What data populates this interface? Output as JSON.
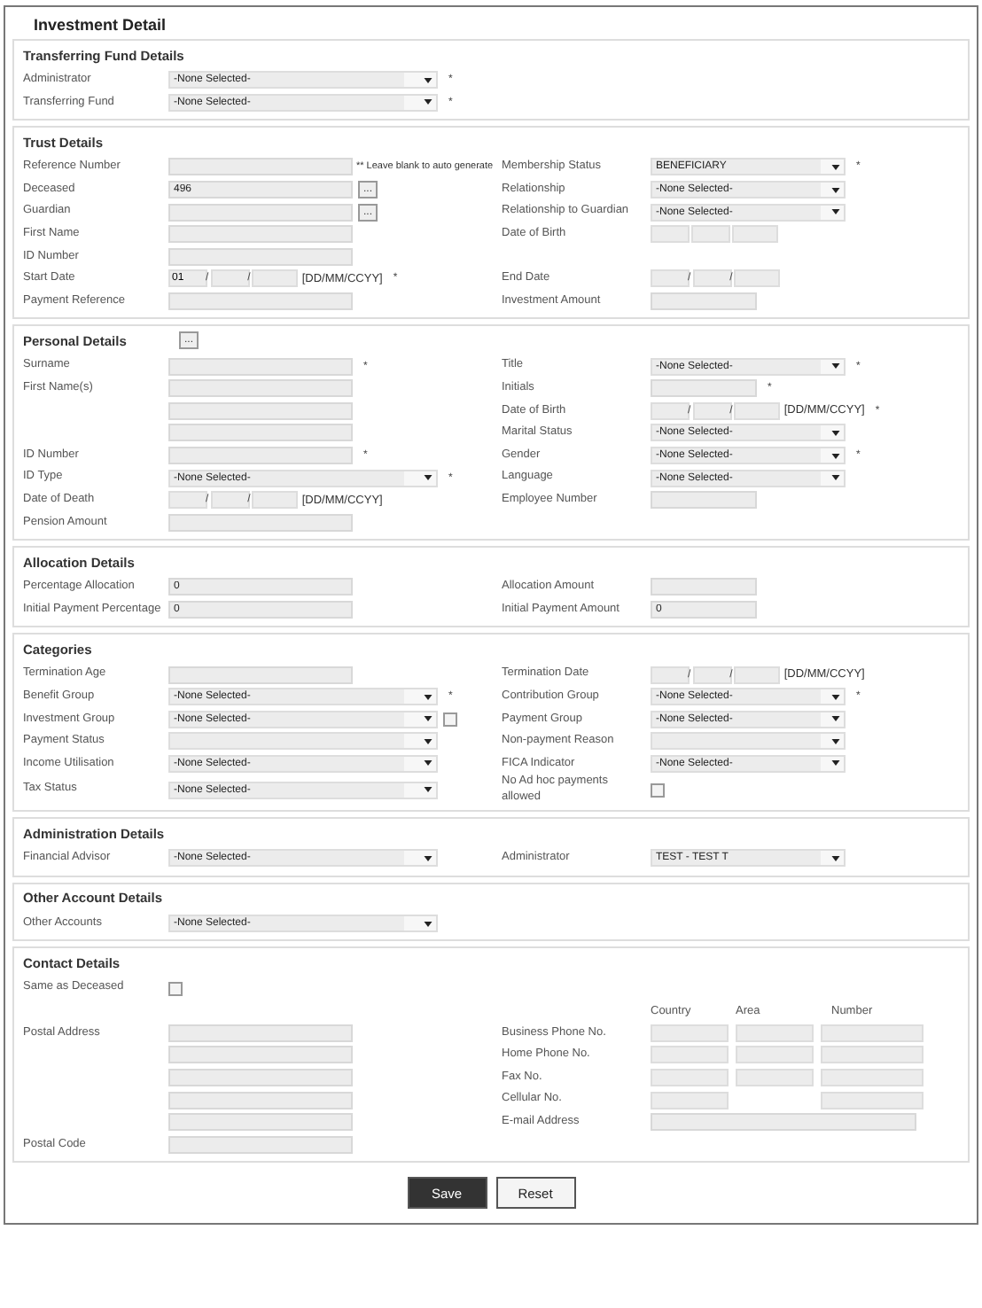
{
  "page_title": "Investment Detail",
  "sections": [
    {
      "title": "Transferring Fund Details",
      "rows": [
        {
          "left": {
            "label": "Administrator",
            "controls": [
              {
                "kind": "select",
                "value": "-None Selected-"
              }
            ],
            "mark": "*"
          }
        },
        {
          "left": {
            "label": "Transferring Fund",
            "controls": [
              {
                "kind": "select",
                "value": "-None Selected-"
              }
            ],
            "mark": "*"
          }
        }
      ]
    },
    {
      "title": "Trust Details",
      "rows": [
        {
          "left": {
            "label": "Reference Number",
            "controls": [
              {
                "kind": "text"
              }
            ],
            "note": "** Leave blank to auto generate"
          },
          "right": {
            "label": "Membership Status",
            "controls": [
              {
                "kind": "select",
                "value": "BENEFICIARY"
              }
            ],
            "mark": "*"
          }
        },
        {
          "left": {
            "label": "Deceased",
            "controls": [
              {
                "kind": "text",
                "value": "496"
              },
              {
                "kind": "button",
                "text": "..."
              }
            ]
          },
          "right": {
            "label": "Relationship",
            "controls": [
              {
                "kind": "select",
                "value": "-None Selected-"
              }
            ]
          }
        },
        {
          "left": {
            "label": "Guardian",
            "controls": [
              {
                "kind": "text"
              },
              {
                "kind": "button",
                "text": "..."
              }
            ]
          },
          "right": {
            "label": "Relationship to Guardian",
            "controls": [
              {
                "kind": "select",
                "value": "-None Selected-"
              }
            ]
          }
        },
        {
          "left": {
            "label": "First Name",
            "controls": [
              {
                "kind": "text"
              }
            ]
          },
          "right": {
            "label": "Date of Birth",
            "controls": [
              {
                "kind": "date"
              }
            ]
          }
        },
        {
          "left": {
            "label": "ID Number",
            "controls": [
              {
                "kind": "text"
              }
            ]
          }
        },
        {
          "left": {
            "label": "Start Date",
            "controls": [
              {
                "kind": "date",
                "day": "01",
                "separator": "/",
                "format": "[DD/MM/CCYY]"
              }
            ],
            "mark": "*"
          },
          "right": {
            "label": "End Date",
            "controls": [
              {
                "kind": "date",
                "separator": "/"
              }
            ]
          }
        },
        {
          "left": {
            "label": "Payment Reference",
            "controls": [
              {
                "kind": "text"
              }
            ]
          },
          "right": {
            "label": "Investment Amount",
            "controls": [
              {
                "kind": "text"
              }
            ]
          }
        }
      ]
    },
    {
      "title": "Personal Details",
      "button": "...",
      "rows": [
        {
          "left": {
            "label": "Surname",
            "controls": [
              {
                "kind": "text"
              }
            ],
            "mark": "*"
          },
          "right": {
            "label": "Title",
            "controls": [
              {
                "kind": "select",
                "value": "-None Selected-"
              }
            ],
            "mark": "*"
          }
        },
        {
          "left": {
            "label": "First Name(s)",
            "controls": [
              {
                "kind": "text"
              }
            ]
          },
          "right": {
            "label": "Initials",
            "controls": [
              {
                "kind": "text"
              }
            ],
            "mark": "*"
          }
        },
        {
          "left": {
            "controls": [
              {
                "kind": "text"
              }
            ]
          },
          "right": {
            "label": "Date of Birth",
            "controls": [
              {
                "kind": "date",
                "separator": "/",
                "format": "[DD/MM/CCYY]"
              }
            ],
            "mark": "*"
          }
        },
        {
          "left": {
            "controls": [
              {
                "kind": "text"
              }
            ]
          },
          "right": {
            "label": "Marital Status",
            "controls": [
              {
                "kind": "select",
                "value": "-None Selected-"
              }
            ]
          }
        },
        {
          "left": {
            "label": "ID Number",
            "controls": [
              {
                "kind": "text"
              }
            ],
            "mark": "*"
          },
          "right": {
            "label": "Gender",
            "controls": [
              {
                "kind": "select",
                "value": "-None Selected-"
              }
            ],
            "mark": "*"
          }
        },
        {
          "left": {
            "label": "ID Type",
            "controls": [
              {
                "kind": "select",
                "value": "-None Selected-"
              }
            ],
            "mark": "*"
          },
          "right": {
            "label": "Language",
            "controls": [
              {
                "kind": "select",
                "value": "-None Selected-"
              }
            ]
          }
        },
        {
          "left": {
            "label": "Date of Death",
            "controls": [
              {
                "kind": "date",
                "separator": "/",
                "format": "[DD/MM/CCYY]"
              }
            ]
          },
          "right": {
            "label": "Employee Number",
            "controls": [
              {
                "kind": "text"
              }
            ]
          }
        },
        {
          "left": {
            "label": "Pension Amount",
            "controls": [
              {
                "kind": "text"
              }
            ]
          }
        }
      ]
    },
    {
      "title": "Allocation Details",
      "rows": [
        {
          "left": {
            "label": "Percentage Allocation",
            "controls": [
              {
                "kind": "text",
                "value": "0"
              }
            ]
          },
          "right": {
            "label": "Allocation Amount",
            "controls": [
              {
                "kind": "text"
              }
            ]
          }
        },
        {
          "left": {
            "label": "Initial Payment Percentage",
            "controls": [
              {
                "kind": "text",
                "value": "0"
              }
            ]
          },
          "right": {
            "label": "Initial Payment Amount",
            "controls": [
              {
                "kind": "text",
                "value": "0"
              }
            ]
          }
        }
      ]
    },
    {
      "title": "Categories",
      "rows": [
        {
          "left": {
            "label": "Termination Age",
            "controls": [
              {
                "kind": "text"
              }
            ]
          },
          "right": {
            "label": "Termination Date",
            "controls": [
              {
                "kind": "date",
                "separator": "/",
                "format": "[DD/MM/CCYY]"
              }
            ]
          }
        },
        {
          "left": {
            "label": "Benefit Group",
            "controls": [
              {
                "kind": "select",
                "value": "-None Selected-"
              }
            ],
            "mark": "*"
          },
          "right": {
            "label": "Contribution Group",
            "controls": [
              {
                "kind": "select",
                "value": "-None Selected-"
              }
            ],
            "mark": "*"
          }
        },
        {
          "left": {
            "label": "Investment Group",
            "controls": [
              {
                "kind": "select",
                "value": "-None Selected-"
              },
              {
                "kind": "checkbox",
                "checked": false
              }
            ]
          },
          "right": {
            "label": "Payment Group",
            "controls": [
              {
                "kind": "select",
                "value": "-None Selected-"
              }
            ]
          }
        },
        {
          "left": {
            "label": "Payment Status",
            "controls": [
              {
                "kind": "select"
              }
            ]
          },
          "right": {
            "label": "Non-payment Reason",
            "controls": [
              {
                "kind": "select"
              }
            ]
          }
        },
        {
          "left": {
            "label": "Income Utilisation",
            "controls": [
              {
                "kind": "select",
                "value": "-None Selected-"
              }
            ]
          },
          "right": {
            "label": "FICA Indicator",
            "controls": [
              {
                "kind": "select",
                "value": "-None Selected-"
              }
            ]
          }
        },
        {
          "left": {
            "label": "Tax Status",
            "controls": [
              {
                "kind": "select",
                "value": "-None Selected-"
              }
            ]
          },
          "right": {
            "label": "No Ad hoc payments allowed",
            "controls": [
              {
                "kind": "checkbox",
                "checked": false
              }
            ]
          }
        }
      ]
    },
    {
      "title": "Administration Details",
      "rows": [
        {
          "left": {
            "label": "Financial Advisor",
            "controls": [
              {
                "kind": "select",
                "value": "-None Selected-"
              }
            ]
          },
          "right": {
            "label": "Administrator",
            "controls": [
              {
                "kind": "select",
                "value": "TEST - TEST T"
              }
            ]
          }
        }
      ]
    },
    {
      "title": "Other Account Details",
      "rows": [
        {
          "left": {
            "label": "Other Accounts",
            "controls": [
              {
                "kind": "select",
                "value": "-None Selected-"
              }
            ]
          }
        }
      ]
    },
    {
      "title": "Contact Details",
      "rows": [
        {
          "left": {
            "label": "Same as Deceased",
            "controls": [
              {
                "kind": "checkbox",
                "checked": false
              }
            ]
          }
        },
        {
          "headings": [
            "Country",
            "Area",
            "Number"
          ]
        },
        {
          "left": {
            "label": "Postal Address",
            "controls": [
              {
                "kind": "text"
              }
            ]
          },
          "right": {
            "label": "Business Phone No.",
            "controls": [
              {
                "kind": "phone",
                "has_area": true
              }
            ]
          }
        },
        {
          "left": {
            "controls": [
              {
                "kind": "text"
              }
            ]
          },
          "right": {
            "label": "Home Phone No.",
            "controls": [
              {
                "kind": "phone",
                "has_area": true
              }
            ]
          }
        },
        {
          "left": {
            "controls": [
              {
                "kind": "text"
              }
            ]
          },
          "right": {
            "label": "Fax No.",
            "controls": [
              {
                "kind": "phone",
                "has_area": true
              }
            ]
          }
        },
        {
          "left": {
            "controls": [
              {
                "kind": "text"
              }
            ]
          },
          "right": {
            "label": "Cellular No.",
            "controls": [
              {
                "kind": "phone",
                "has_area": false
              }
            ]
          }
        },
        {
          "left": {
            "controls": [
              {
                "kind": "text"
              }
            ]
          },
          "right": {
            "label": "E-mail Address",
            "controls": [
              {
                "kind": "email"
              }
            ]
          }
        },
        {
          "left": {
            "label": "Postal Code",
            "controls": [
              {
                "kind": "text"
              }
            ]
          }
        }
      ]
    }
  ],
  "buttons": [
    {
      "label": "Save",
      "kind": "primary"
    },
    {
      "label": "Reset",
      "kind": "secondary"
    }
  ]
}
